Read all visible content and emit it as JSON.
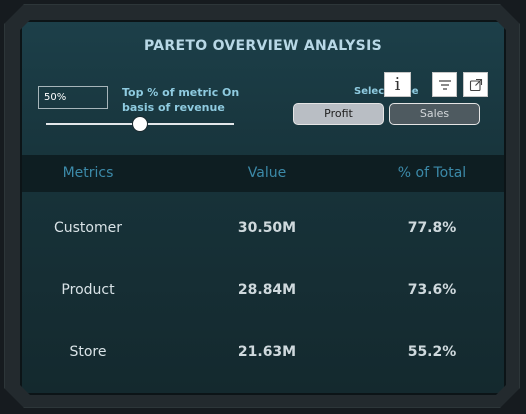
{
  "title": "PARETO OVERVIEW ANALYSIS",
  "threshold": {
    "value_text": "50%",
    "description": "Top % of metric On basis of revenue",
    "slider_level": 0.5
  },
  "select_label": "Select Type",
  "toolbar": {
    "info_icon": "info-icon",
    "filter_icon": "filter-icon",
    "focus_icon": "focus-mode-icon"
  },
  "type_buttons": [
    {
      "label": "Profit",
      "selected": true
    },
    {
      "label": "Sales",
      "selected": false
    }
  ],
  "table": {
    "headers": [
      "Metrics",
      "Value",
      "% of Total"
    ],
    "rows": [
      {
        "metric": "Customer",
        "value": "30.50M",
        "pct": "77.8%"
      },
      {
        "metric": "Product",
        "value": "28.84M",
        "pct": "73.6%"
      },
      {
        "metric": "Store",
        "value": "21.63M",
        "pct": "55.2%"
      }
    ]
  },
  "colors": {
    "panel_bg": "#173239",
    "header_text": "#3c8aa9",
    "accent_text": "#8fcbe0"
  }
}
